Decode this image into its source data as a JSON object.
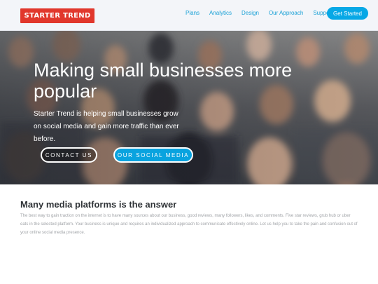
{
  "header": {
    "logo_text": "STARTER TREND",
    "nav": [
      {
        "label": "Plans"
      },
      {
        "label": "Analytics"
      },
      {
        "label": "Design"
      },
      {
        "label": "Our Approach"
      },
      {
        "label": "Support"
      }
    ],
    "cta_label": "Get Started"
  },
  "hero": {
    "title": "Making small businesses more popular",
    "subtitle": "Starter Trend is helping small businesses grow on social media and gain more traffic than ever before.",
    "contact_button": "CONTACT US",
    "social_button": "OUR SOCIAL MEDIA"
  },
  "section": {
    "title": "Many media platforms is the answer",
    "body": "The best way to gain traction on the internet is to have many sources about our business, good reviews, many followers, likes, and comments. Five star reviews, grub hub or uber eats in the selected platform. Your business is unique and requires an individualized approach to communicate effectively online. Let us help you to take the pain and confusion out of your online social media presence."
  },
  "colors": {
    "brand_red": "#e1372c",
    "accent_blue": "#07a8e6",
    "link_blue": "#1aa1d6",
    "nav_bg": "#f3f5f9"
  }
}
